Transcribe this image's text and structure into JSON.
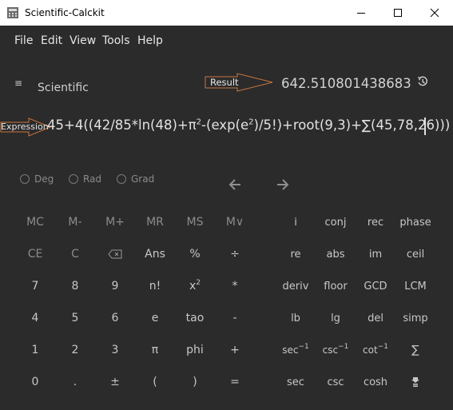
{
  "window": {
    "title": "Scientific-Calckit"
  },
  "menu": [
    {
      "id": "file",
      "label": "File"
    },
    {
      "id": "edit",
      "label": "Edit"
    },
    {
      "id": "view",
      "label": "View"
    },
    {
      "id": "tools",
      "label": "Tools"
    },
    {
      "id": "help",
      "label": "Help"
    }
  ],
  "header": {
    "mode_label": "Scientific",
    "result_callout": "Result",
    "result_value": "642.510801438683",
    "expression_callout": "Expression"
  },
  "expression": {
    "part1": "45+4((42/85*ln(48)+π",
    "sup1": "2",
    "part2": "-(exp(e",
    "sup2": "2",
    "part3": ")/5!)+root(9,3)+∑(45,78,26)))"
  },
  "angle_units": [
    {
      "id": "deg",
      "label": "Deg"
    },
    {
      "id": "rad",
      "label": "Rad"
    },
    {
      "id": "grad",
      "label": "Grad"
    }
  ],
  "keys": {
    "mc": "MC",
    "mminus": "M-",
    "mplus": "M+",
    "mr": "MR",
    "ms": "MS",
    "mv": "M∨",
    "ce": "CE",
    "c": "C",
    "ans": "Ans",
    "percent": "%",
    "divide": "÷",
    "n7": "7",
    "n8": "8",
    "n9": "9",
    "factorial": "n!",
    "square": "x",
    "square_sup": "2",
    "multiply": "*",
    "n4": "4",
    "n5": "5",
    "n6": "6",
    "e": "e",
    "tao": "tao",
    "minus": "-",
    "n1": "1",
    "n2": "2",
    "n3": "3",
    "pi": "π",
    "phi": "phi",
    "plus": "+",
    "n0": "0",
    "dot": ".",
    "plusminus": "±",
    "lparen": "(",
    "rparen": ")",
    "equals": "=",
    "i": "i",
    "conj": "conj",
    "rec": "rec",
    "phase": "phase",
    "re": "re",
    "abs": "abs",
    "im": "im",
    "ceil": "ceil",
    "deriv": "deriv",
    "floor": "floor",
    "gcd": "GCD",
    "lcm": "LCM",
    "lb": "lb",
    "lg": "lg",
    "del": "del",
    "simp": "simp",
    "sec_inv": "sec",
    "csc_inv": "csc",
    "cot_inv": "cot",
    "inv_sup": "−1",
    "sum": "∑",
    "sec": "sec",
    "csc": "csc",
    "cosh": "cosh"
  },
  "colors": {
    "background": "#2b2b2b",
    "titlebar": "#ffffff",
    "callout_stroke": "#c8743f",
    "text": "#c7c7c7"
  }
}
